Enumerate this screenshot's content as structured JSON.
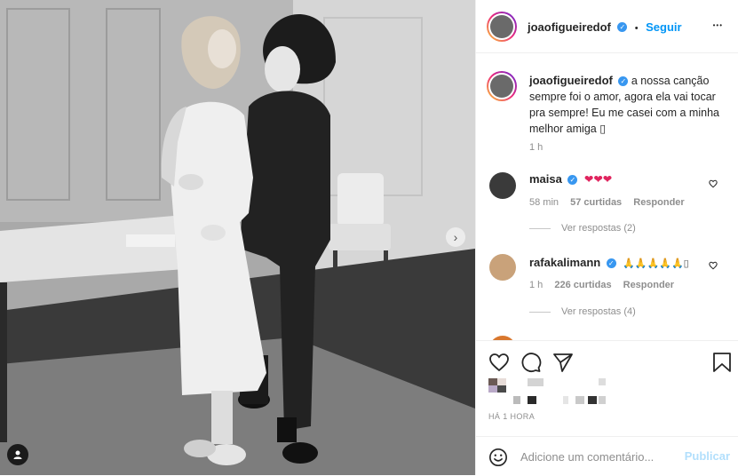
{
  "post": {
    "author": "joaofigueiredof",
    "verified_glyph": "✓",
    "follow_separator": "•",
    "follow_label": "Seguir",
    "more_label": "•••",
    "photo_description_icon": "photo",
    "next_icon": "chevron-right-icon",
    "tag_icon": "user-tag-icon"
  },
  "caption": {
    "username": "joaofigueiredof",
    "text": "a nossa canção sempre foi o amor, agora ela vai tocar pra sempre! Eu me casei com a minha melhor amiga",
    "emoji_glyph": "▯",
    "age": "1 h"
  },
  "comments": [
    {
      "username": "maisa",
      "verified": true,
      "text": "❤❤❤",
      "age": "58 min",
      "likes": "57 curtidas",
      "reply_label": "Responder",
      "view_replies": "Ver respostas (2)",
      "avatar_color": "#3a3a3a"
    },
    {
      "username": "rafakalimann",
      "verified": true,
      "text": "🙏🙏🙏🙏🙏▯",
      "age": "1 h",
      "likes": "226 curtidas",
      "reply_label": "Responder",
      "view_replies": "Ver respostas (4)",
      "avatar_color": "#c9a27a"
    }
  ],
  "actions": {
    "like_icon": "heart-outline-icon",
    "comment_icon": "comment-bubble-icon",
    "share_icon": "paper-plane-icon",
    "save_icon": "bookmark-icon"
  },
  "timestamp": "HÁ 1 HORA",
  "comment_box": {
    "placeholder": "Adicione um comentário...",
    "publish_label": "Publicar",
    "emoji_icon": "smiley-icon"
  },
  "colors": {
    "accent": "#0095f6",
    "verified": "#3897f0",
    "muted": "#8e8e8e",
    "border": "#efefef",
    "heart": "#e0245e"
  }
}
